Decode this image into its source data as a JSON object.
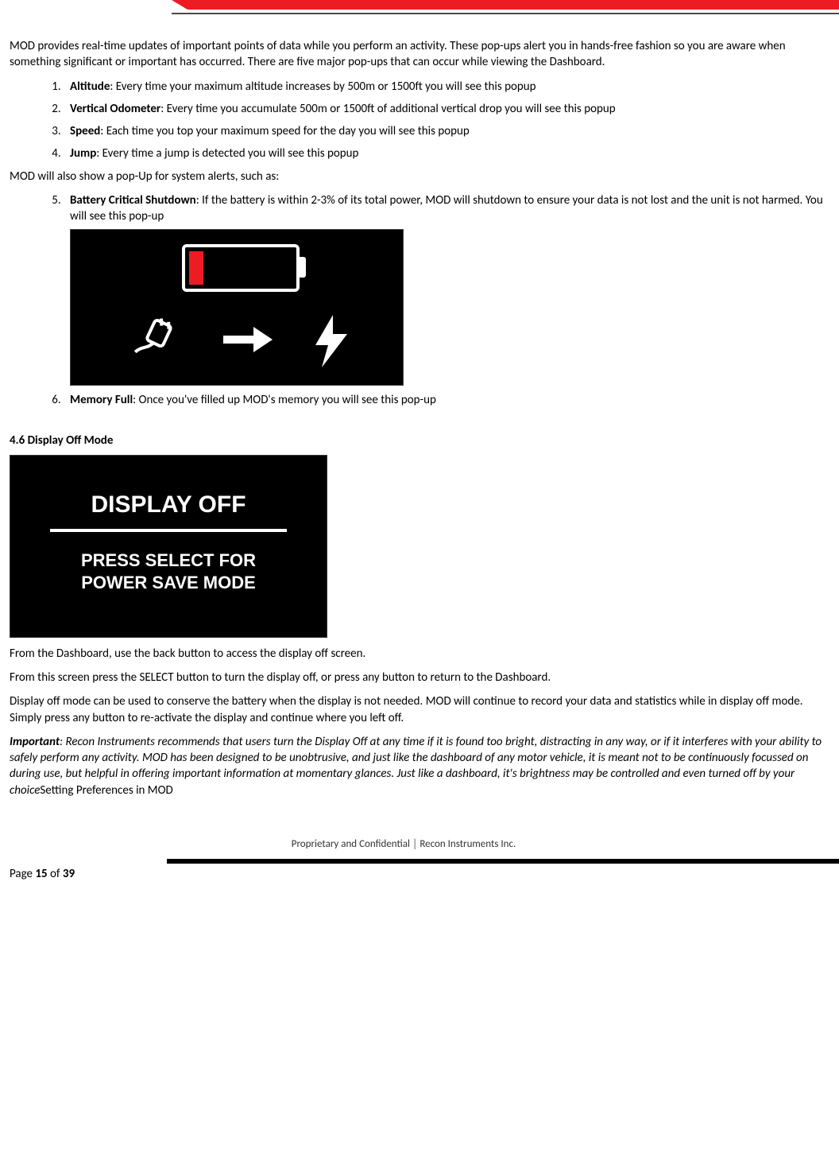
{
  "intro": "MOD provides real-time updates of important points of data while you perform an activity.  These pop-ups alert you in hands-free fashion so you are aware when something significant or important has occurred. There are five major pop-ups that can occur while viewing the Dashboard.",
  "list1": [
    {
      "term": "Altitude",
      "desc": ": Every time your maximum altitude increases by 500m or 1500ft you will see this popup"
    },
    {
      "term": "Vertical Odometer",
      "desc": ": Every time you accumulate 500m or 1500ft of additional vertical drop you will see this popup"
    },
    {
      "term": "Speed",
      "desc": ": Each time you top your maximum speed for the day you will see this popup"
    },
    {
      "term": "Jump",
      "desc": ": Every time a jump is detected you will see this popup"
    }
  ],
  "mid_para": "MOD will also show a pop-Up for system alerts, such as:",
  "list2": [
    {
      "term": "Battery Critical Shutdown",
      "desc": ": If the battery is within 2-3% of its total power, MOD will shutdown to ensure your data is not lost and the unit is not harmed.  You will see this pop-up"
    },
    {
      "term": "Memory Full",
      "desc": ": Once you've filled up MOD's memory you will see this pop-up"
    }
  ],
  "section_heading": "4.6  Display Off Mode",
  "display_off": {
    "title": "DISPLAY OFF",
    "line1": "PRESS SELECT FOR",
    "line2": "POWER SAVE MODE"
  },
  "para_a": "From the Dashboard, use the back button to access the display off screen.",
  "para_b": "From this screen press the SELECT button to turn the display off, or press any button to return to the Dashboard.",
  "para_c": " Display off mode can be used to conserve the battery when the display is not needed. MOD will continue to record your data and statistics while in display off mode. Simply press any button to re-activate the display and continue where you left off.",
  "important": {
    "lead": "Important",
    "body": ": Recon Instruments recommends that users turn the Display Off at any time if it is found too bright, distracting in any way, or if it interferes with your ability to safely perform any activity. MOD has been designed to be unobtrusive, and just like the dashboard of any motor vehicle, it is meant not to be continuously focussed on during use, but helpful in offering important information at momentary glances. Just like a dashboard, it's brightness may be controlled and even turned off by your choice",
    "tail": "Setting Preferences in MOD"
  },
  "footer": {
    "center": "Proprietary and Confidential  │  Recon Instruments Inc.",
    "page_prefix": "Page ",
    "page_num": "15",
    "page_mid": " of ",
    "page_total": "39"
  }
}
